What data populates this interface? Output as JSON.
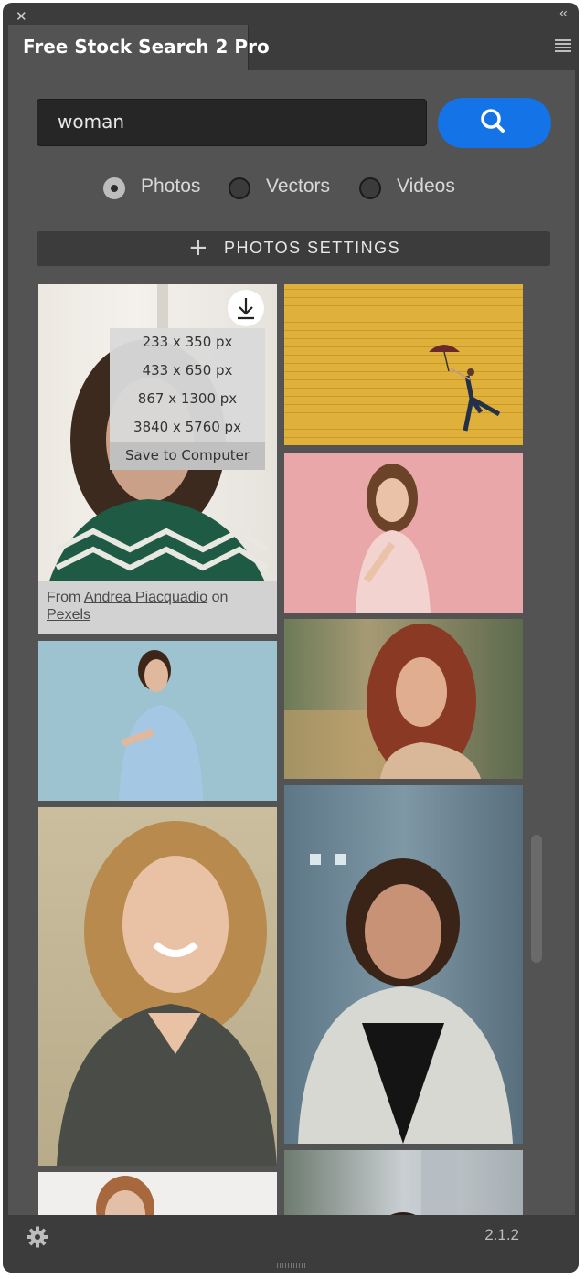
{
  "window": {
    "tab_title": "Free Stock Search 2 Pro",
    "version": "2.1.2"
  },
  "search": {
    "value": "woman"
  },
  "media_types": [
    {
      "label": "Photos",
      "selected": true
    },
    {
      "label": "Vectors",
      "selected": false
    },
    {
      "label": "Videos",
      "selected": false
    }
  ],
  "settings_bar": {
    "label": "PHOTOS SETTINGS"
  },
  "download_menu": {
    "options": [
      "233 x 350 px",
      "433 x 650 px",
      "867 x 1300 px",
      "3840 x 5760 px",
      "Save to Computer"
    ],
    "highlighted": "Save to Computer"
  },
  "credit": {
    "prefix": "From",
    "author": "Andrea Piacquadio",
    "on": "on",
    "source": "Pexels"
  },
  "icons": [
    "close-icon",
    "collapse-icon",
    "panel-menu-icon",
    "search-icon",
    "download-icon",
    "gear-icon"
  ],
  "colors": {
    "accent": "#1473e6",
    "panel": "#535353",
    "chrome": "#3c3c3c"
  }
}
